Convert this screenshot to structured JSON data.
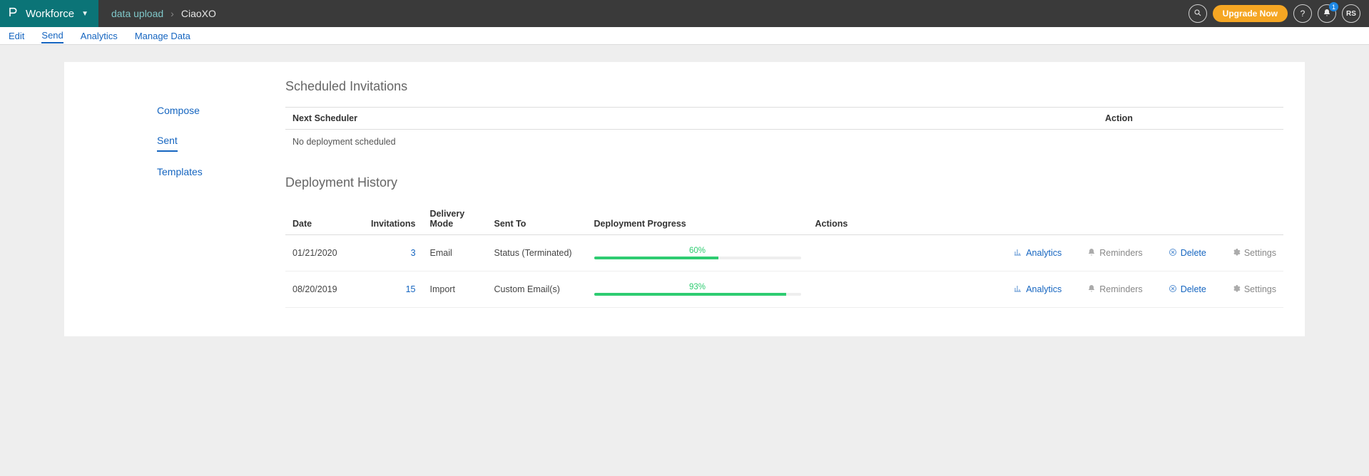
{
  "topbar": {
    "brand": "Workforce",
    "breadcrumb_parent": "data upload",
    "breadcrumb_current": "CiaoXO",
    "upgrade_label": "Upgrade Now",
    "notification_count": "1",
    "avatar_initials": "RS"
  },
  "tabs": {
    "items": [
      {
        "label": "Edit"
      },
      {
        "label": "Send"
      },
      {
        "label": "Analytics"
      },
      {
        "label": "Manage Data"
      }
    ]
  },
  "sidenav": {
    "items": [
      {
        "label": "Compose"
      },
      {
        "label": "Sent"
      },
      {
        "label": "Templates"
      }
    ]
  },
  "scheduled": {
    "title": "Scheduled Invitations",
    "col_scheduler": "Next Scheduler",
    "col_action": "Action",
    "empty_msg": "No deployment scheduled"
  },
  "history": {
    "title": "Deployment History",
    "cols": {
      "date": "Date",
      "invitations": "Invitations",
      "delivery_mode": "Delivery Mode",
      "sent_to": "Sent To",
      "progress": "Deployment Progress",
      "actions": "Actions"
    },
    "rows": [
      {
        "date": "01/21/2020",
        "invitations": "3",
        "mode": "Email",
        "sent_to": "Status (Terminated)",
        "progress_label": "60%",
        "progress_pct": 60
      },
      {
        "date": "08/20/2019",
        "invitations": "15",
        "mode": "Import",
        "sent_to": "Custom Email(s)",
        "progress_label": "93%",
        "progress_pct": 93
      }
    ],
    "action_labels": {
      "analytics": "Analytics",
      "reminders": "Reminders",
      "delete": "Delete",
      "settings": "Settings"
    }
  }
}
